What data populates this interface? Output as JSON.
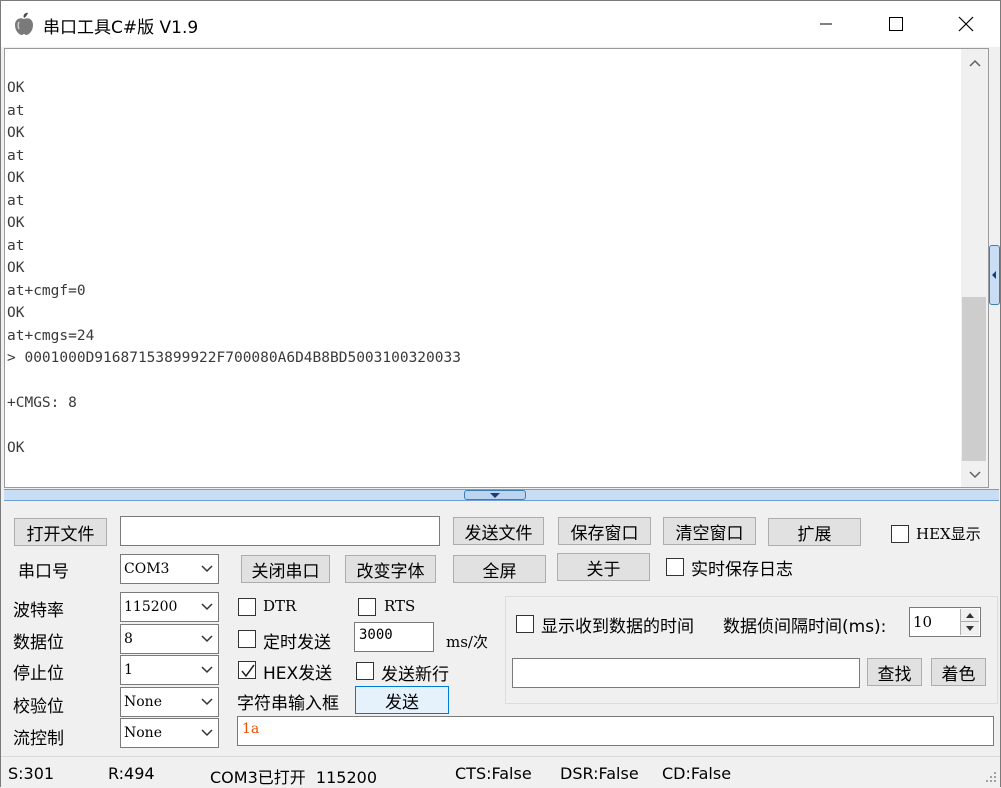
{
  "window": {
    "title": "串口工具C#版  V1.9",
    "icons": {
      "app": "apple-icon",
      "minimize": "minimize-icon",
      "maximize": "maximize-icon",
      "close": "close-icon"
    }
  },
  "receive": {
    "lines": [
      "OK",
      "at",
      "OK",
      "at",
      "OK",
      "at",
      "OK",
      "at",
      "OK",
      "at+cmgf=0",
      "OK",
      "at+cmgs=24",
      "> 0001000D91687153899922F700080A6D4B8BD5003100320033",
      "",
      "+CMGS: 8",
      "",
      "OK"
    ]
  },
  "toolbar": {
    "open_file": "打开文件",
    "file_path": "",
    "send_file": "发送文件",
    "save_window": "保存窗口",
    "clear_window": "清空窗口",
    "extend": "扩展",
    "hex_display": "HEX显示"
  },
  "port": {
    "port_label": "串口号",
    "port_value": "COM3",
    "close_port": "关闭串口",
    "change_font": "改变字体",
    "fullscreen": "全屏",
    "about": "关于",
    "realtime_log": "实时保存日志",
    "baud_label": "波特率",
    "baud_value": "115200",
    "databits_label": "数据位",
    "databits_value": "8",
    "stopbits_label": "停止位",
    "stopbits_value": "1",
    "parity_label": "校验位",
    "parity_value": "None",
    "flow_label": "流控制",
    "flow_value": "None"
  },
  "send": {
    "dtr": "DTR",
    "rts": "RTS",
    "timed_send": "定时发送",
    "interval_value": "3000",
    "interval_unit": "ms/次",
    "hex_send": "HEX发送",
    "hex_send_checked": true,
    "send_newline": "发送新行",
    "string_input_label": "字符串输入框",
    "send_button": "发送",
    "input_value": "1a"
  },
  "ext": {
    "show_time": "显示收到数据的时间",
    "frame_interval_label": "数据侦间隔时间(ms):",
    "frame_interval_value": "10",
    "search_value": "",
    "find": "查找",
    "colorize": "着色"
  },
  "status": {
    "sent": "S:301",
    "received": "R:494",
    "port_state": "COM3已打开  115200",
    "cts": "CTS:False",
    "dsr": "DSR:False",
    "cd": "CD:False"
  },
  "colors": {
    "titlebar": "#ffffff",
    "accent": "#0078d7",
    "splitter": "#c9def5",
    "input_text": "#e8500a"
  }
}
